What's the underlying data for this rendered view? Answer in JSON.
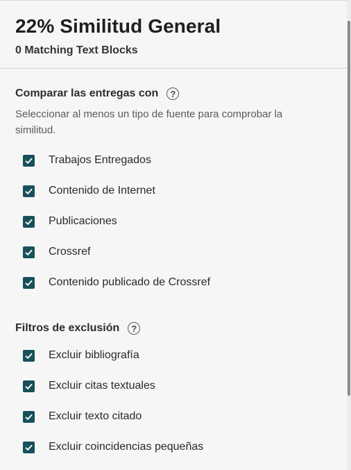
{
  "header": {
    "title": "22% Similitud General",
    "subtitle": "0 Matching Text Blocks"
  },
  "compare": {
    "heading": "Comparar las entregas con",
    "help_icon": "question-circle-icon",
    "help_glyph": "?",
    "description": "Seleccionar al menos un tipo de fuente para comprobar la similitud.",
    "options": [
      {
        "label": "Trabajos Entregados",
        "checked": true
      },
      {
        "label": "Contenido de Internet",
        "checked": true
      },
      {
        "label": "Publicaciones",
        "checked": true
      },
      {
        "label": "Crossref",
        "checked": true
      },
      {
        "label": "Contenido publicado de Crossref",
        "checked": true
      }
    ]
  },
  "filters": {
    "heading": "Filtros de exclusión",
    "help_icon": "question-circle-icon",
    "help_glyph": "?",
    "options": [
      {
        "label": "Excluir bibliografía",
        "checked": true
      },
      {
        "label": "Excluir citas textuales",
        "checked": true
      },
      {
        "label": "Excluir texto citado",
        "checked": true
      },
      {
        "label": "Excluir coincidencias pequeñas",
        "checked": true
      }
    ]
  },
  "colors": {
    "checkbox": "#17505a",
    "background": "#f6f6f6"
  }
}
